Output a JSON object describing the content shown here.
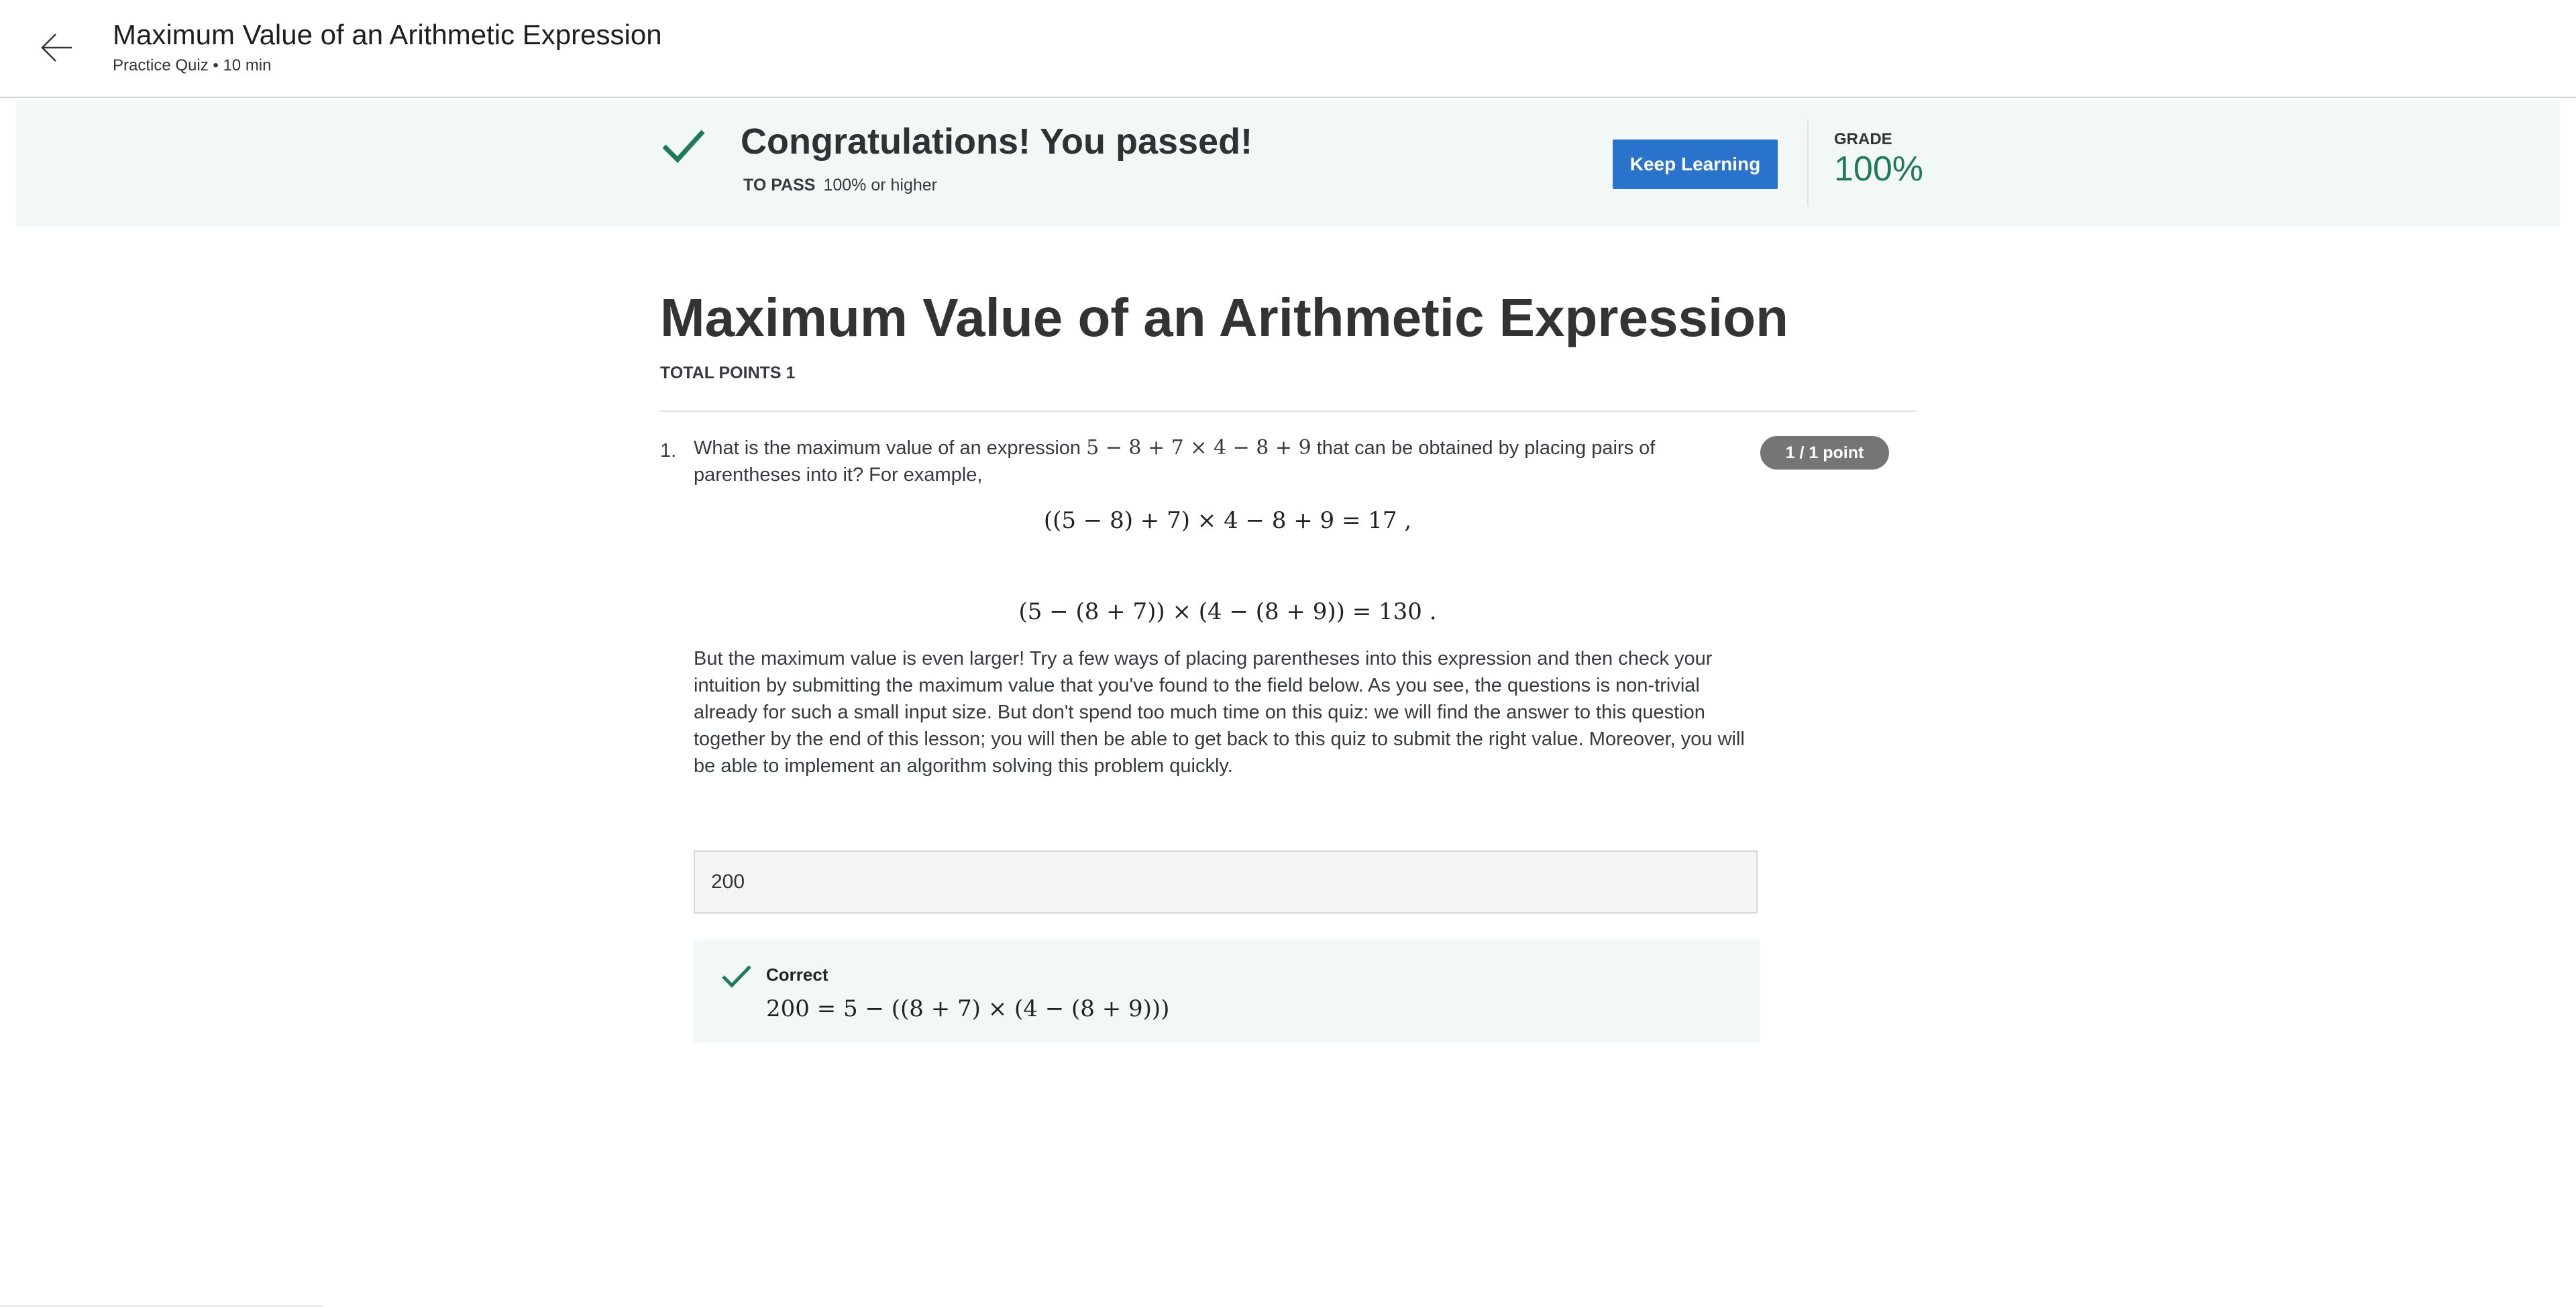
{
  "header": {
    "back_icon": "arrow-left-icon",
    "title": "Maximum Value of an Arithmetic Expression",
    "subtitle": "Practice Quiz • 10 min"
  },
  "result_banner": {
    "check_icon": "checkmark-icon",
    "headline": "Congratulations! You passed!",
    "to_pass_label": "TO PASS",
    "to_pass_value": "100% or higher",
    "keep_learning_label": "Keep Learning",
    "grade_label": "GRADE",
    "grade_value": "100%",
    "accent_color": "#1f7a59",
    "button_color": "#2a73cc",
    "background_color": "#f2f8f6"
  },
  "quiz": {
    "title": "Maximum Value of an Arithmetic Expression",
    "total_points": "TOTAL POINTS 1"
  },
  "question": {
    "number": "1.",
    "text_before": "What is the maximum value of an expression ",
    "expression": "5 − 8 + 7 × 4 − 8 + 9",
    "text_after": " that can be obtained by placing pairs of parentheses into it? For example,",
    "points_badge": "1 / 1 point",
    "example_1": "((5 − 8) + 7) × 4 − 8 + 9 = 17 ,",
    "example_2": "(5 − (8 + 7)) × (4 − (8 + 9)) = 130 .",
    "paragraph": "But the maximum value is even larger! Try a few ways of placing parentheses into this expression and then check your intuition by submitting the maximum value that you've found to the field below. As you see, the questions is non-trivial already for such a small input size. But don't spend too much time on this quiz: we will find the answer to this question together by the end of this lesson; you will then be able to get back to this quiz to submit the right value. Moreover, you will be able to implement an algorithm solving this problem quickly.",
    "answer_value": "200",
    "feedback_label": "Correct",
    "feedback_explanation": "200 = 5 − ((8 + 7) × (4 − (8 + 9)))"
  }
}
